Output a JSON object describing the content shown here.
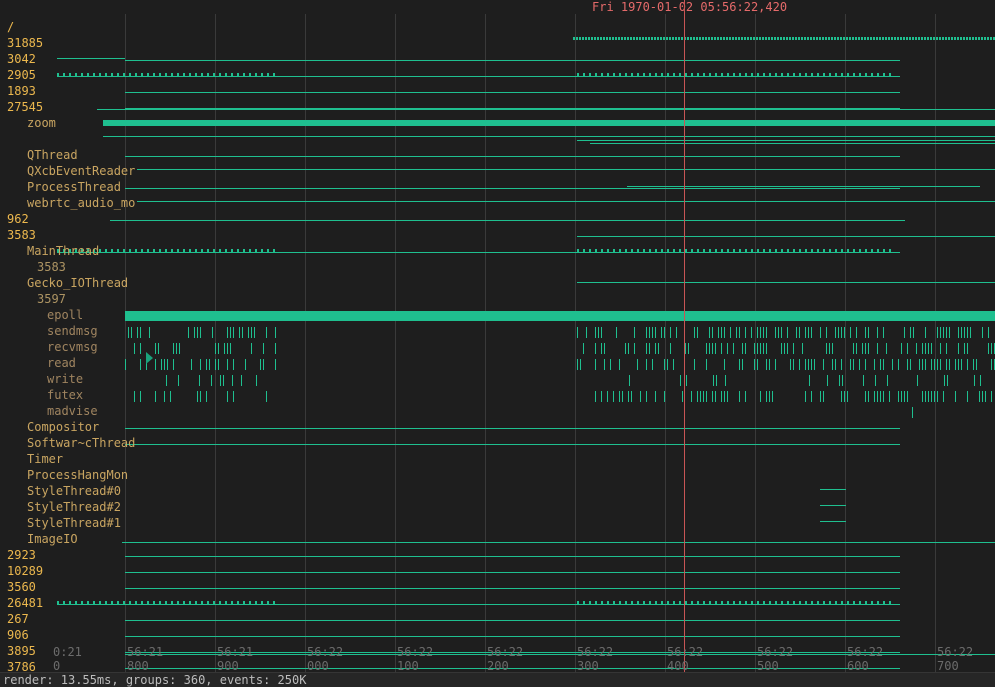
{
  "header": {
    "cursor_time": "Fri 1970-01-02 05:56:22,420"
  },
  "colors": {
    "track": "#1fbf8f",
    "accent_dark": "#1aa37c",
    "cursor": "#c85555",
    "header_text": "#e56a6a",
    "label_process": "#ecb84e",
    "label_thread": "#c9a561",
    "background": "#1e1e1e"
  },
  "tree": [
    {
      "label": "/",
      "level": 0,
      "kind": "root"
    },
    {
      "label": "31885",
      "level": 0,
      "kind": "empty"
    },
    {
      "label": "3042",
      "level": 0,
      "kind": "line"
    },
    {
      "label": "2905",
      "level": 0,
      "kind": "dotted"
    },
    {
      "label": "1893",
      "level": 0,
      "kind": "line"
    },
    {
      "label": "27545",
      "level": 0,
      "kind": "line"
    },
    {
      "label": "zoom",
      "level": 1,
      "kind": "band"
    },
    {
      "label": "",
      "level": 1,
      "kind": "lines"
    },
    {
      "label": "QThread",
      "level": 1,
      "kind": "line"
    },
    {
      "label": "QXcbEventReader",
      "level": 1,
      "kind": "sparse"
    },
    {
      "label": "ProcessThread",
      "level": 1,
      "kind": "line"
    },
    {
      "label": "webrtc_audio_mo",
      "level": 1,
      "kind": "sparse"
    },
    {
      "label": "962",
      "level": 0,
      "kind": "line"
    },
    {
      "label": "3583",
      "level": 0,
      "kind": "empty"
    },
    {
      "label": "MainThread",
      "level": 1,
      "kind": "dotted"
    },
    {
      "label": "3583",
      "level": 2,
      "kind": "empty"
    },
    {
      "label": "Gecko_IOThread",
      "level": 1,
      "kind": "empty"
    },
    {
      "label": "3597",
      "level": 2,
      "kind": "empty"
    },
    {
      "label": "epoll",
      "level": 3,
      "kind": "solid"
    },
    {
      "label": "sendmsg",
      "level": 3,
      "kind": "bars"
    },
    {
      "label": "recvmsg",
      "level": 3,
      "kind": "bars"
    },
    {
      "label": "read",
      "level": 3,
      "kind": "bars"
    },
    {
      "label": "write",
      "level": 3,
      "kind": "sparsebars"
    },
    {
      "label": "futex",
      "level": 3,
      "kind": "bars"
    },
    {
      "label": "madvise",
      "level": 3,
      "kind": "single"
    },
    {
      "label": "Compositor",
      "level": 1,
      "kind": "line"
    },
    {
      "label": "Softwar~cThread",
      "level": 1,
      "kind": "line"
    },
    {
      "label": "Timer",
      "level": 1,
      "kind": "empty"
    },
    {
      "label": "ProcessHangMon",
      "level": 1,
      "kind": "empty"
    },
    {
      "label": "StyleThread#0",
      "level": 1,
      "kind": "short"
    },
    {
      "label": "StyleThread#2",
      "level": 1,
      "kind": "short"
    },
    {
      "label": "StyleThread#1",
      "level": 1,
      "kind": "short"
    },
    {
      "label": "ImageIO",
      "level": 1,
      "kind": "empty"
    },
    {
      "label": "2923",
      "level": 0,
      "kind": "line"
    },
    {
      "label": "10289",
      "level": 0,
      "kind": "line"
    },
    {
      "label": "3560",
      "level": 0,
      "kind": "line"
    },
    {
      "label": "26481",
      "level": 0,
      "kind": "dotted"
    },
    {
      "label": "267",
      "level": 0,
      "kind": "line"
    },
    {
      "label": "906",
      "level": 0,
      "kind": "line"
    },
    {
      "label": "3895",
      "level": 0,
      "kind": "line"
    },
    {
      "label": "3786",
      "level": 0,
      "kind": "line"
    }
  ],
  "time_ticks": [
    {
      "top": "0:21",
      "bottom": "0"
    },
    {
      "top": "56:21",
      "bottom": "800"
    },
    {
      "top": "56:21",
      "bottom": "900"
    },
    {
      "top": "56:22",
      "bottom": "000"
    },
    {
      "top": "56:22",
      "bottom": "100"
    },
    {
      "top": "56:22",
      "bottom": "200"
    },
    {
      "top": "56:22",
      "bottom": "300"
    },
    {
      "top": "56:22",
      "bottom": "400"
    },
    {
      "top": "56:22",
      "bottom": "500"
    },
    {
      "top": "56:22",
      "bottom": "600"
    },
    {
      "top": "56:22",
      "bottom": "700"
    }
  ],
  "status": {
    "text": "render: 13.55ms, groups: 360, events: 250K"
  }
}
